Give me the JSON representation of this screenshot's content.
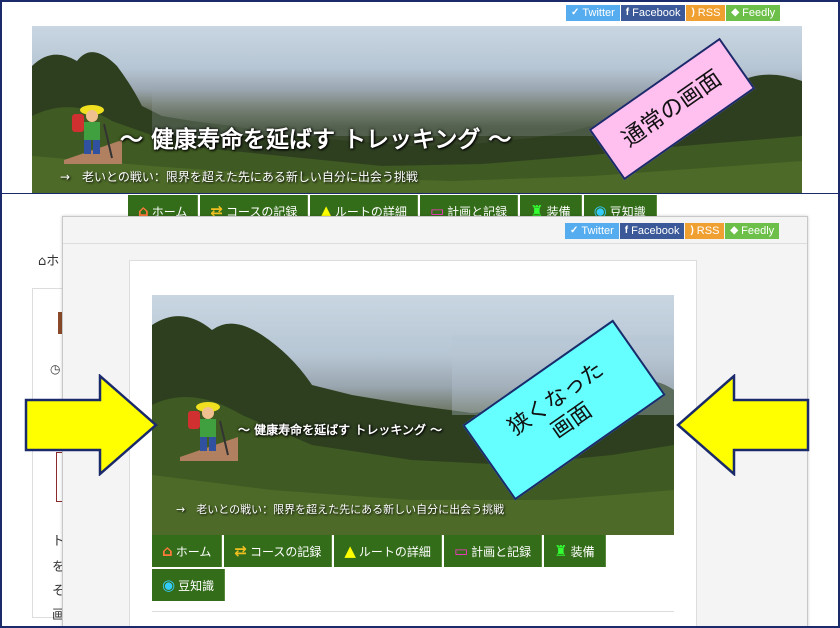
{
  "social": {
    "twitter": "Twitter",
    "facebook": "Facebook",
    "rss": "RSS",
    "feedly": "Feedly"
  },
  "site": {
    "title": "～ 健康寿命を延ばす トレッキング ～",
    "description": "→　老いとの戦い：限界を超えた先にある新しい自分に出会う挑戦"
  },
  "nav": [
    {
      "label": "ホーム",
      "icon": "home-icon",
      "color": "#ff7a3a"
    },
    {
      "label": "コースの記録",
      "icon": "repeat-icon",
      "color": "#f0c020"
    },
    {
      "label": "ルートの詳細",
      "icon": "road-icon",
      "color": "#ffff00"
    },
    {
      "label": "計画と記録",
      "icon": "monitor-icon",
      "color": "#ff33cc"
    },
    {
      "label": "装備",
      "icon": "shirt-icon",
      "color": "#33ff33"
    },
    {
      "label": "豆知識",
      "icon": "eye-icon",
      "color": "#33ccff"
    }
  ],
  "callouts": {
    "normal": "通常の画面",
    "narrow_line1": "狭くなった",
    "narrow_line2": "画面"
  },
  "peek": {
    "breadcrumb_home": "ホ",
    "chars": [
      "ト",
      "を",
      "そ",
      "画"
    ]
  },
  "colors": {
    "nav_bg": "#346d1a",
    "callout_normal_bg": "#ffc0f0",
    "callout_narrow_bg": "#66ffff",
    "arrow_fill": "#ffff00",
    "arrow_stroke": "#1a2a6a"
  }
}
